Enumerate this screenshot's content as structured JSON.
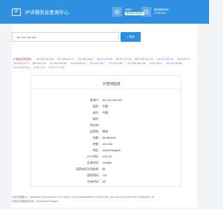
{
  "header": {
    "logo_text": "IP",
    "title": "IP详细信息查询中心",
    "your_ip": {
      "label": "当前IP",
      "value": "36.133.120.160"
    },
    "update": {
      "label": "最近更新时间",
      "value": "10/30/1021"
    },
    "bg_color": "#2f8fe0"
  },
  "search": {
    "input_value": "36.133.120.160",
    "button_label": "查询"
  },
  "history": {
    "label": "IP 最近访问查询：",
    "items": [
      "36.133.120.160",
      "167.158.36.172",
      "231.164.164.1",
      "95.247.227.84",
      "95.247.227.84",
      "185.138.100.144",
      "113.251.152.16",
      "99.22.62.33",
      "169.225.137.4",
      "189.96.32.31",
      "37.251.245.187",
      "113.245.62.51",
      "175.122.135.7",
      "175.122.135.7",
      "113.252.150.194",
      "76.90.150.2",
      "113.102.96.201",
      "113.102.96.201",
      "2.241.2.43",
      "116.37.37.225"
    ]
  },
  "card": {
    "title": "IP查询信息",
    "rows": [
      {
        "label": "查询IP：",
        "value": "36.133.120.160"
      },
      {
        "label": "国家：",
        "value": "中国"
      },
      {
        "label": "省份：",
        "value": "中国"
      },
      {
        "label": "城市：",
        "value": ""
      },
      {
        "label": "所在地：",
        "value": ""
      },
      {
        "label": "运营商：",
        "value": "移动"
      },
      {
        "label": "纬度：",
        "value": "36.894402"
      },
      {
        "label": "经度：",
        "value": "104.166"
      },
      {
        "label": "时区：",
        "value": "Asia/Shanghai"
      },
      {
        "label": "UTC时区：",
        "value": "UTC+8"
      },
      {
        "label": "区域代码：",
        "value": "100000"
      },
      {
        "label": "国家电话号码前缀：",
        "value": "86"
      },
      {
        "label": "国家简码：",
        "value": "CN"
      },
      {
        "label": "大洲代码：",
        "value": "AP"
      }
    ]
  },
  "footer": {
    "ua": "当前浏览器UA：Mozilla/5.0 (Windows NT 10.0; Win64; x64) AppleWebKit/537.36 (KHTML, like Gecko) Chrome/120.0 Safari/537.36",
    "lang": "当前浏览器语言支持：Accept/Ne/Testcapa"
  }
}
